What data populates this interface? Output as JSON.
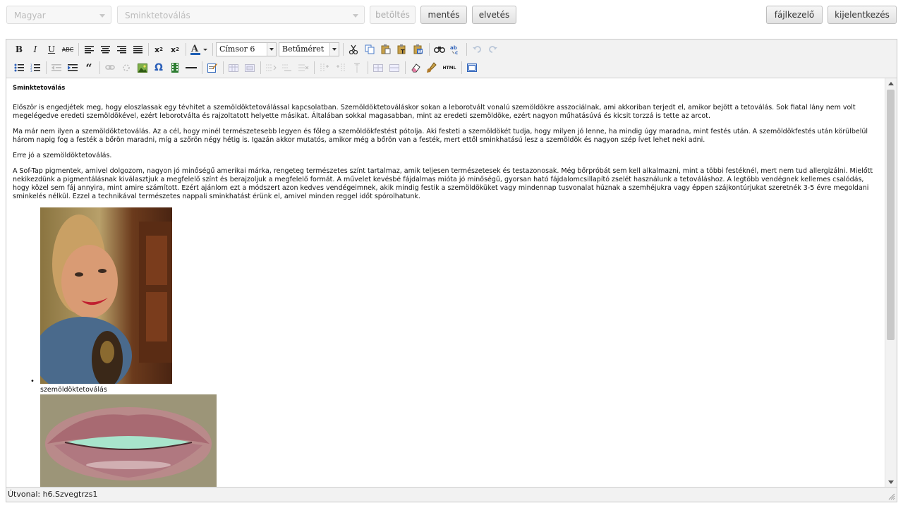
{
  "header": {
    "language_select": "Magyar",
    "page_select": "Sminktetoválás",
    "load_label": "betöltés",
    "save_label": "mentés",
    "discard_label": "elvetés",
    "filemanager_label": "fájlkezelő",
    "logout_label": "kijelentkezés"
  },
  "toolbar": {
    "format_select": "Címsor 6",
    "fontsize_select": "Betűméret"
  },
  "content": {
    "heading": "Sminktetoválás",
    "paragraphs": [
      "Először is engedjétek meg, hogy eloszlassak egy tévhitet a szemöldöktetoválással kapcsolatban. Szemöldöktetováláskor sokan a leborotvált vonalú szemöldökre asszociálnak, ami akkoriban terjedt el, amikor bejött a tetoválás. Sok fiatal lány nem volt megelégedve eredeti szemöldökével, ezért leborotválta és rajzoltatott helyette másikat. Általában sokkal magasabban, mint az eredeti szemöldöke, ezért nagyon műhatásúvá és kicsit torzzá is tette az arcot.",
      "Ma már nem ilyen a szemöldöktetoválás. Az a cél, hogy minél természetesebb legyen és főleg a szemöldökfestést pótolja. Aki festeti a szemöldökét tudja, hogy milyen jó lenne, ha mindig úgy maradna, mint festés után. A szemöldökfestés után körülbelül három napig fog a festék a bőrön maradni, míg a szőrön négy hétig is. Igazán akkor mutatós, amikor még a bőrön van a festék, mert ettől sminkhatású lesz a szemöldök és nagyon szép ívet lehet neki adni.",
      "Erre jó a szemöldöktetoválás.",
      "A Sof-Tap pigmentek, amivel dolgozom, nagyon jó minőségű amerikai márka, rengeteg természetes színt tartalmaz, amik teljesen természetesek és testazonosak. Még bőrpróbát sem kell alkalmazni, mint a többi festéknél, mert nem tud allergizálni. Mielőtt nekikezdünk a pigmentálásnak kiválasztjuk a megfelelő színt és berajzoljuk a megfelelő formát. A művelet kevésbé fájdalmas mióta jó minőségű, gyorsan ható fájdalomcsillapító zselét használunk a tetováláshoz. A legtöbb vendégnek kellemes csalódás, hogy közel sem fáj annyira, mint amire számított. Ezért ajánlom ezt a módszert azon kedves vendégeimnek, akik mindig festik a szemöldöküket vagy mindennap tusvonalat húznak a szemhéjukra vagy éppen szájkontúrjukat szeretnék 3-5 évre megoldani sminkelés nélkül. Ezzel a technikával természetes nappali sminkhatást érünk el, amivel minden reggel időt spórolhatunk."
    ],
    "list_bullet": "•",
    "caption": "szemöldöktetoválás"
  },
  "status": {
    "path": "Útvonal: h6.Szvegtrzs1"
  }
}
